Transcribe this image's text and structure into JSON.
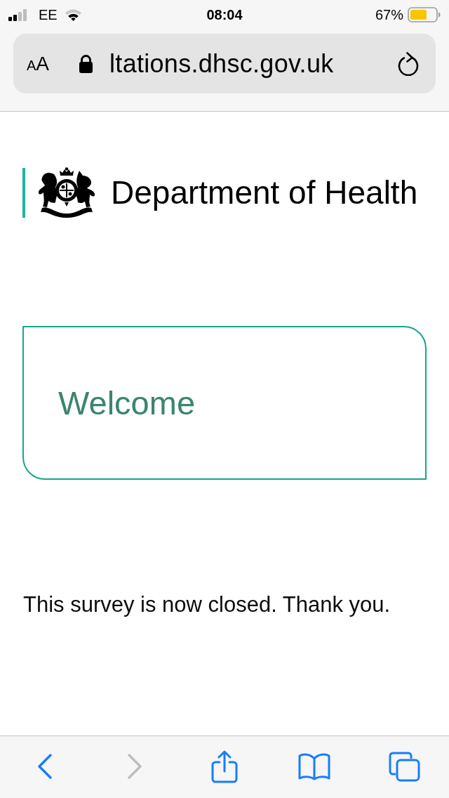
{
  "status_bar": {
    "carrier": "EE",
    "time": "08:04",
    "battery": "67%"
  },
  "address_bar": {
    "text_size_button": {
      "small_letter": "A",
      "large_letter": "A"
    },
    "url": "ltations.dhsc.gov.uk"
  },
  "page": {
    "organisation": "Department of Health",
    "welcome_panel": {
      "heading": "Welcome"
    },
    "message": "This survey is now closed. Thank you."
  },
  "toolbar": {
    "buttons": [
      {
        "kind": "back",
        "disabled": false
      },
      {
        "kind": "forward",
        "disabled": true
      },
      {
        "kind": "share",
        "disabled": false
      },
      {
        "kind": "bookmarks",
        "disabled": false
      },
      {
        "kind": "tabs",
        "disabled": false
      }
    ]
  }
}
